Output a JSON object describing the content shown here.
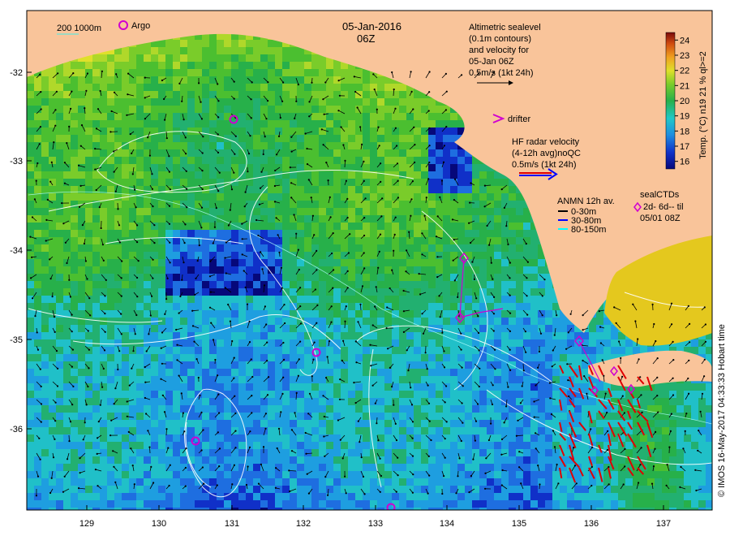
{
  "title": {
    "date": "05-Jan-2016",
    "time": "06Z"
  },
  "legend_top_left": {
    "scale_depths": "200  1000m",
    "argo": "Argo"
  },
  "altimetry": {
    "lines": [
      "Altimetric sealevel",
      "(0.1m contours)",
      "and velocity for",
      "05-Jan 06Z",
      "0.5m/s (1kt 24h)"
    ]
  },
  "drifter": "drifter",
  "hf_radar": {
    "lines": [
      "HF radar velocity",
      "(4-12h avg)noQC",
      "0.5m/s (1kt 24h)"
    ]
  },
  "anmn": {
    "title": "ANMN 12h av.",
    "items": [
      {
        "label": "0-30m",
        "color": "#000000"
      },
      {
        "label": "30-80m",
        "color": "#0000ff"
      },
      {
        "label": "80-150m",
        "color": "#00ffff"
      }
    ]
  },
  "sealctds": {
    "lines": [
      "sealCTDs",
      "2d- 6d-- til",
      "05/01 08Z"
    ]
  },
  "colorbar": {
    "label": "Temp. (°C) n19 21 % ql>=2",
    "ticks": [
      "24",
      "23",
      "22",
      "21",
      "20",
      "19",
      "18",
      "17",
      "16"
    ],
    "min": 15.5,
    "max": 24.5
  },
  "axes": {
    "x_ticks": [
      "129",
      "130",
      "131",
      "132",
      "133",
      "134",
      "135",
      "136",
      "137"
    ],
    "y_ticks": [
      "-32",
      "-33",
      "-34",
      "-35",
      "-36"
    ]
  },
  "credit": "© IMOS 16-May-2017 04:33:33 Hobart time",
  "colors": {
    "land": "#f9c49a",
    "argo": "#d000d0",
    "hf_red": "#e00000",
    "hf_blue": "#0000ff"
  }
}
